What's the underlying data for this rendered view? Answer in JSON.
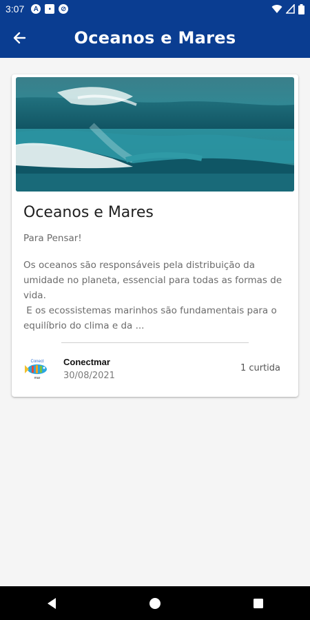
{
  "status_bar": {
    "time": "3:07",
    "icons": [
      "a-badge-icon",
      "sd-card-icon",
      "no-sync-icon",
      "wifi-icon",
      "signal-icon",
      "battery-icon"
    ]
  },
  "app_bar": {
    "title": "Oceanos e Mares",
    "back_icon": "arrow-left-icon",
    "color": "#0a3d91"
  },
  "post": {
    "image": "ocean-waves-image",
    "title": "Oceanos e Mares",
    "subtitle": "Para Pensar!",
    "body_lines": [
      "Os oceanos são responsáveis pela distribuição da",
      "umidade no planeta, essencial para todas as formas de",
      "vida.",
      " E os ecossistemas marinhos são fundamentais para o",
      "equilíbrio do clima e da ..."
    ],
    "author": "Conectmar",
    "date": "30/08/2021",
    "likes": "1 curtida"
  },
  "nav_bar": {
    "back": "nav-back-icon",
    "home": "nav-home-icon",
    "recents": "nav-recents-icon"
  }
}
